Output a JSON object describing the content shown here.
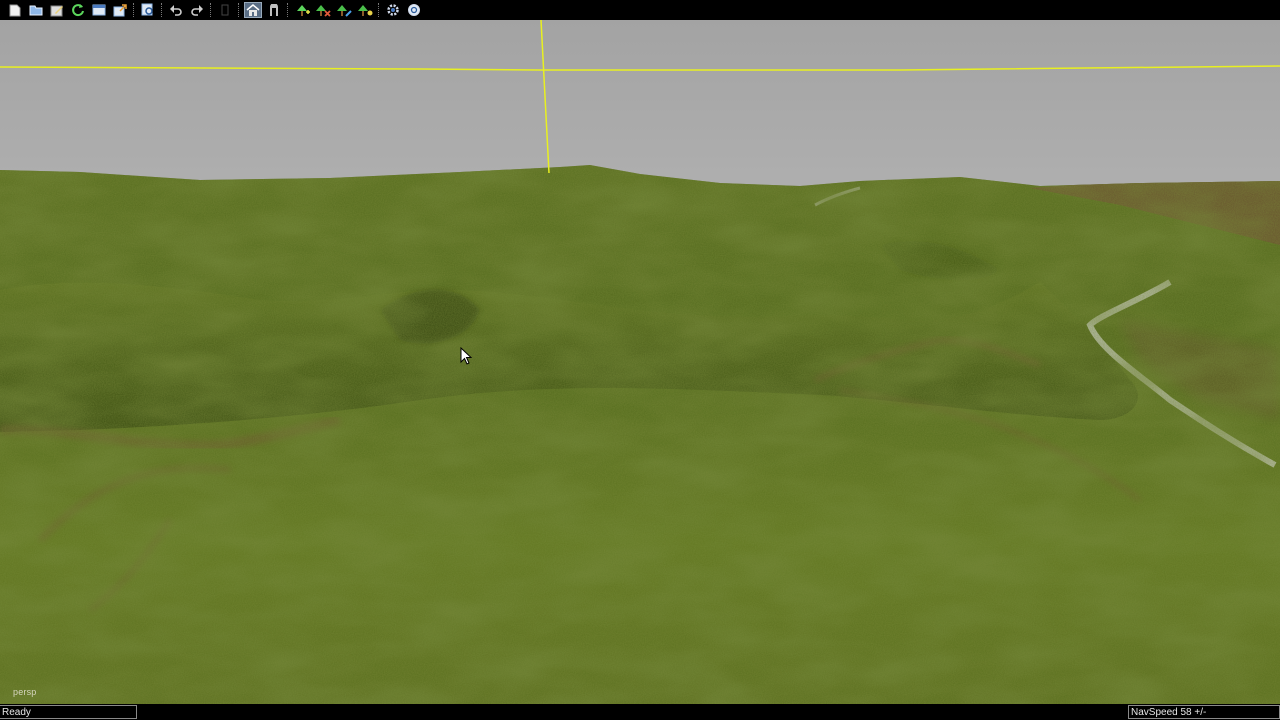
{
  "toolbar": {
    "buttons": [
      {
        "name": "new-document-icon",
        "color": "#f2f2f2"
      },
      {
        "name": "open-folder-icon",
        "color": "#8fb8e8"
      },
      {
        "name": "edit-icon",
        "color": "#e8d07a"
      },
      {
        "name": "refresh-icon",
        "color": "#5cd65c"
      },
      {
        "name": "window-icon",
        "color": "#8fb8e8"
      },
      {
        "name": "export-icon",
        "color": "#8fb8e8"
      },
      {
        "name": "search-icon",
        "color": "#8fb8e8"
      },
      {
        "name": "undo-icon",
        "color": "#cfcfcf"
      },
      {
        "name": "redo-icon",
        "color": "#cfcfcf"
      },
      {
        "name": "home-icon",
        "color": "#e8e8e8",
        "active": true
      },
      {
        "name": "bookmark-icon",
        "color": "#bfbfbf"
      },
      {
        "name": "tree-add-icon",
        "color": "#5cd65c"
      },
      {
        "name": "tree-red-icon",
        "color": "#e05a3a"
      },
      {
        "name": "tree-blue-icon",
        "color": "#4aa0e8"
      },
      {
        "name": "tree-yellow-icon",
        "color": "#e8d24a"
      },
      {
        "name": "settings-icon",
        "color": "#cfd8e8"
      },
      {
        "name": "globe-settings-icon",
        "color": "#cfd8e8"
      }
    ]
  },
  "viewport": {
    "camera_label": "persp",
    "sky_color": "#a9a9a9",
    "grass_color": "#5a6e1c",
    "axis_color": "#e8f020"
  },
  "status": {
    "left_text": "Ready",
    "right_text": "NavSpeed 58 +/-"
  }
}
